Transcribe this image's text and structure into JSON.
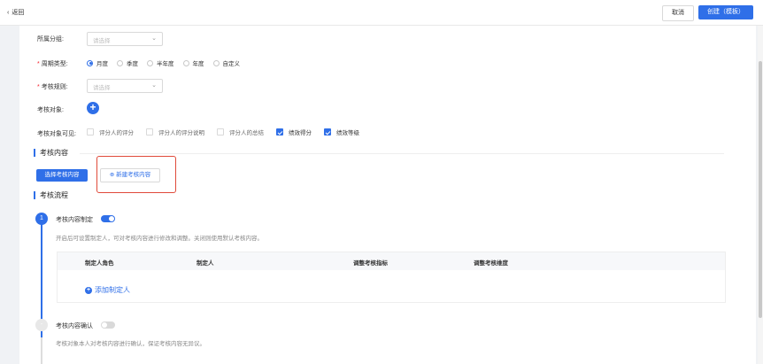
{
  "topbar": {
    "back_label": "返回",
    "back_icon": "chevron-left-icon",
    "cancel_label": "取消",
    "create_label": "创建（模板）"
  },
  "form": {
    "group_label": "所属分组:",
    "group_placeholder": "请选择",
    "cycle_label": "周期类型:",
    "cycle_options": [
      "月度",
      "季度",
      "半年度",
      "年度",
      "自定义"
    ],
    "cycle_selected": "月度",
    "rule_label": "考核规则:",
    "rule_placeholder": "请选择",
    "target_label": "考核对象:",
    "visible_label": "考核对象可见:",
    "visible_options": [
      {
        "label": "评分人的评分",
        "checked": false
      },
      {
        "label": "评分人的评分说明",
        "checked": false
      },
      {
        "label": "评分人的总结",
        "checked": false
      },
      {
        "label": "绩效得分",
        "checked": true
      },
      {
        "label": "绩效等级",
        "checked": true
      }
    ]
  },
  "content_section": {
    "title": "考核内容",
    "select_button": "选择考核内容",
    "new_button": "新建考核内容"
  },
  "flow_section": {
    "title": "考核流程",
    "steps": [
      {
        "number": "1",
        "title": "考核内容制定",
        "toggle_on": true,
        "desc": "开启后可设置制定人，可对考核内容进行修改和调整。关闭则使用默认考核内容。",
        "table_headers": [
          "制定人角色",
          "制定人",
          "调整考核指标",
          "调整考核维度"
        ],
        "add_label": "添加制定人"
      },
      {
        "number": "-",
        "title": "考核内容确认",
        "toggle_on": false,
        "desc": "考核对象本人对考核内容进行确认，保证考核内容无异议。"
      }
    ]
  },
  "colors": {
    "primary": "#2f6fe8",
    "highlight": "#e04a3a",
    "required": "#f5222d"
  }
}
